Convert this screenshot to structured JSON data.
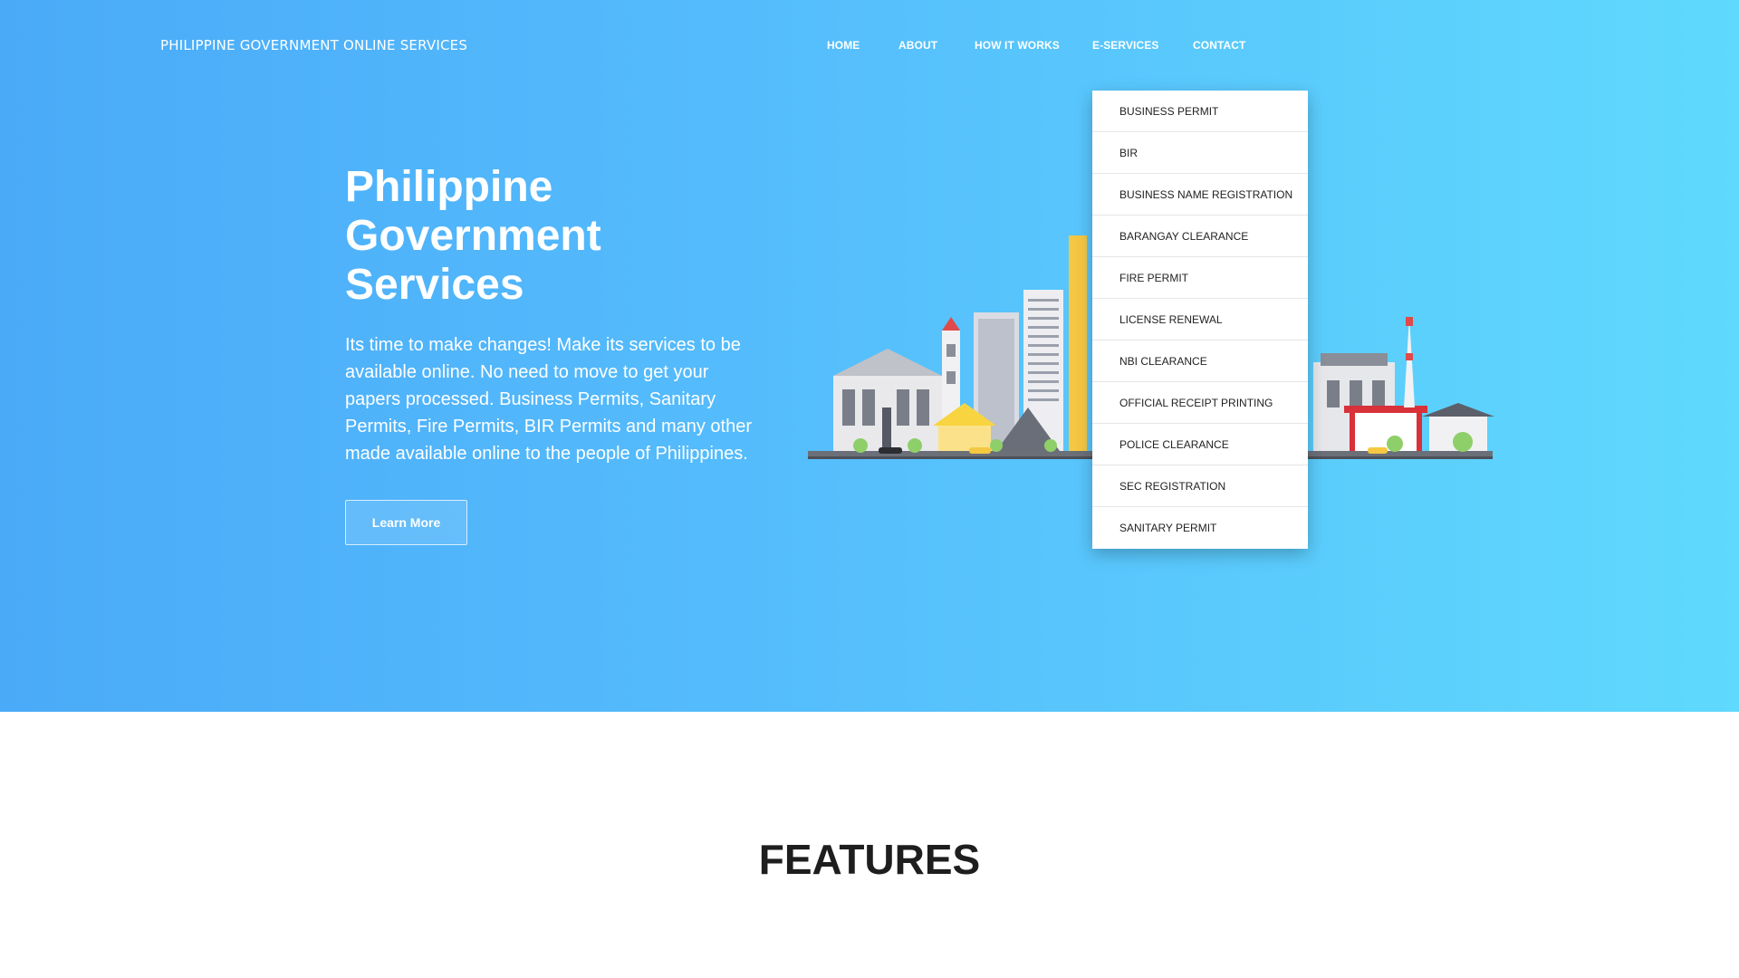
{
  "header": {
    "brand": "PHILIPPINE GOVERNMENT ONLINE SERVICES",
    "nav": {
      "home": "HOME",
      "about": "ABOUT",
      "how_it_works": "HOW IT WORKS",
      "e_services": "E-SERVICES",
      "contact": "CONTACT"
    }
  },
  "hero": {
    "title_line1": "Philippine",
    "title_line2": "Government",
    "title_line3": "Services",
    "description": "Its time to make changes! Make its services to be available online. No need to move to get your papers processed. Business Permits, Sanitary Permits, Fire Permits, BIR Permits and many other made available online to the people of Philippines.",
    "cta_label": "Learn More",
    "gradient_start": "#4aaaf8",
    "gradient_end": "#5fd9fd"
  },
  "e_services_menu": {
    "items": [
      "BUSINESS PERMIT",
      "BIR",
      "BUSINESS NAME REGISTRATION",
      "BARANGAY CLEARANCE",
      "FIRE PERMIT",
      "LICENSE RENEWAL",
      "NBI CLEARANCE",
      "OFFICIAL RECEIPT PRINTING",
      "POLICE CLEARANCE",
      "SEC REGISTRATION",
      "SANITARY PERMIT"
    ]
  },
  "features": {
    "title": "FEATURES"
  },
  "illustration": {
    "icon": "city-skyline-illustration"
  }
}
